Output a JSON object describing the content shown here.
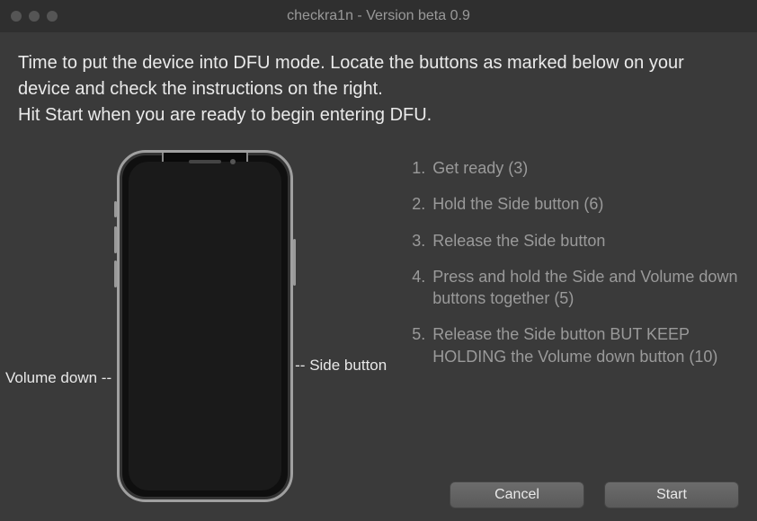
{
  "window": {
    "title": "checkra1n - Version beta 0.9"
  },
  "header": {
    "text": "Time to put the device into DFU mode. Locate the buttons as marked below on your device and check the instructions on the right.\nHit Start when you are ready to begin entering DFU."
  },
  "labels": {
    "volume_down": "Volume down --",
    "side_tick": "--",
    "side_button": "Side button"
  },
  "steps": [
    {
      "num": "1.",
      "text": "Get ready (3)"
    },
    {
      "num": "2.",
      "text": "Hold the Side button (6)"
    },
    {
      "num": "3.",
      "text": "Release the Side button"
    },
    {
      "num": "4.",
      "text": "Press and hold the Side and Volume down buttons together (5)"
    },
    {
      "num": "5.",
      "text": "Release the Side button BUT KEEP HOLDING the Volume down button (10)"
    }
  ],
  "buttons": {
    "cancel": "Cancel",
    "start": "Start"
  }
}
